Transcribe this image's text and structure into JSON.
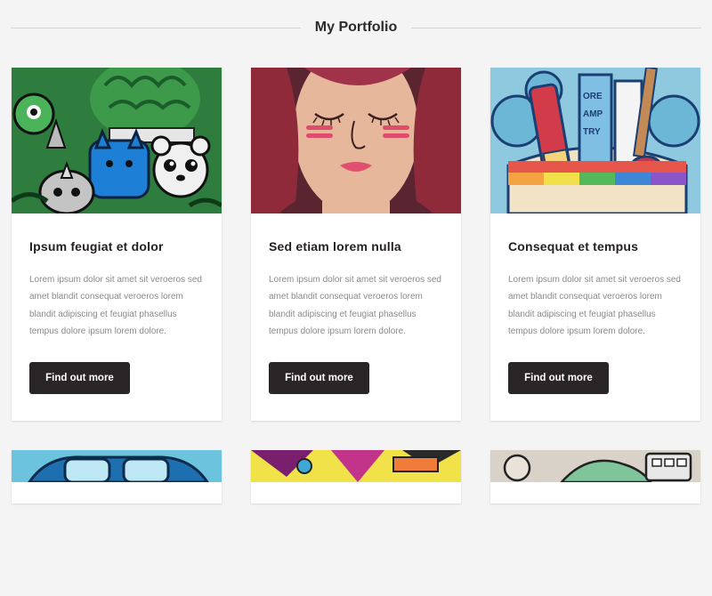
{
  "section": {
    "title": "My Portfolio"
  },
  "cards": [
    {
      "title": "Ipsum feugiat et dolor",
      "text": "Lorem ipsum dolor sit amet sit veroeros sed amet blandit consequat veroeros lorem blandit adipiscing et feugiat phasellus tempus dolore ipsum lorem dolore.",
      "button": "Find out more",
      "image": "doodle-art-animals-image"
    },
    {
      "title": "Sed etiam lorem nulla",
      "text": "Lorem ipsum dolor sit amet sit veroeros sed amet blandit consequat veroeros lorem blandit adipiscing et feugiat phasellus tempus dolore ipsum lorem dolore.",
      "button": "Find out more",
      "image": "girl-illustration-image"
    },
    {
      "title": "Consequat et tempus",
      "text": "Lorem ipsum dolor sit amet sit veroeros sed amet blandit consequat veroeros lorem blandit adipiscing et feugiat phasellus tempus dolore ipsum lorem dolore.",
      "button": "Find out more",
      "image": "art-supplies-image"
    }
  ],
  "colors": {
    "background": "#f4f4f4",
    "card": "#ffffff",
    "button": "#2a2526",
    "heading": "#252122",
    "body_text": "#8a8a8a"
  }
}
